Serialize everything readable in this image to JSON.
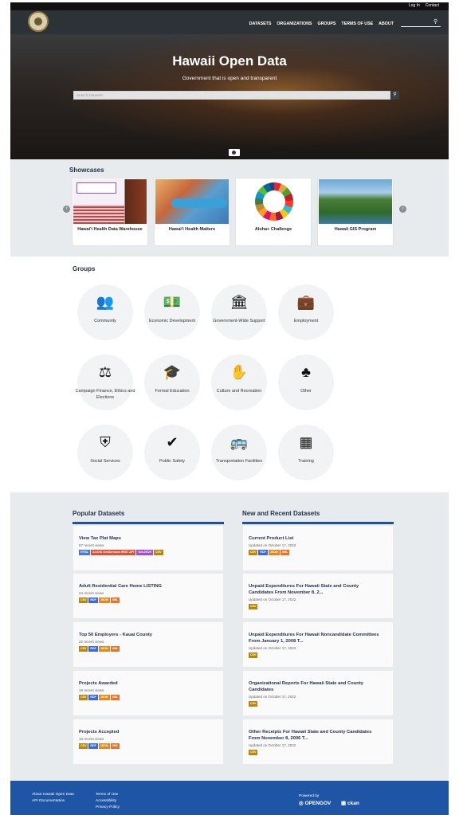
{
  "topbar": {
    "login": "Log In",
    "contact": "Contact"
  },
  "nav": {
    "items": [
      "DATASETS",
      "ORGANIZATIONS",
      "GROUPS",
      "TERMS OF USE",
      "ABOUT"
    ],
    "search_icon": "search-icon"
  },
  "hero": {
    "title": "Hawaii Open Data",
    "subtitle": "Government that is open and transparent",
    "search_placeholder": "Search Datasets",
    "search_icon": "search-icon"
  },
  "showcases": {
    "title": "Showcases",
    "items": [
      {
        "label": "Hawai'i Health Data Warehouse"
      },
      {
        "label": "Hawai'i Health Matters"
      },
      {
        "label": "Aloha+ Challenge"
      },
      {
        "label": "Hawaii GIS Program"
      }
    ],
    "prev_icon": "chevron-left-icon",
    "next_icon": "chevron-right-icon"
  },
  "groups": {
    "title": "Groups",
    "items": [
      {
        "label": "Community",
        "icon": "people-icon"
      },
      {
        "label": "Economic Development",
        "icon": "money-icon"
      },
      {
        "label": "Government-Wide Support",
        "icon": "building-icon"
      },
      {
        "label": "Employment",
        "icon": "employment-icon"
      },
      {
        "label": "Campaign Finance, Ethics and Elections",
        "icon": "campaign-icon"
      },
      {
        "label": "Formal Education",
        "icon": "graduation-cap-icon"
      },
      {
        "label": "Culture and Recreation",
        "icon": "hands-icon"
      },
      {
        "label": "Other",
        "icon": "puzzle-icon"
      },
      {
        "label": "Social Services",
        "icon": "shield-icon"
      },
      {
        "label": "Public Safety",
        "icon": "badge-check-icon"
      },
      {
        "label": "Transportation Facilities",
        "icon": "bus-icon"
      },
      {
        "label": "Training",
        "icon": "board-icon"
      }
    ]
  },
  "popular": {
    "title": "Popular Datasets",
    "items": [
      {
        "title": "View Tax Plat Maps",
        "meta": "87 recent views",
        "tags": [
          "HTML",
          "ArcGIS GeoServices REST API",
          "GeoJSON",
          "CSV"
        ]
      },
      {
        "title": "Adult Residential Care Home LISTING",
        "meta": "24 recent views",
        "tags": [
          "CSV",
          "RDF",
          "JSON",
          "XML"
        ]
      },
      {
        "title": "Top 50 Employers - Kauai County",
        "meta": "22 recent views",
        "tags": [
          "CSV",
          "RDF",
          "JSON",
          "XML"
        ]
      },
      {
        "title": "Projects Awarded",
        "meta": "19 recent views",
        "tags": [
          "CSV",
          "RDF",
          "JSON",
          "XML"
        ]
      },
      {
        "title": "Projects Accepted",
        "meta": "18 recent views",
        "tags": [
          "CSV",
          "RDF",
          "JSON",
          "XML"
        ]
      }
    ]
  },
  "recent": {
    "title": "New and Recent Datasets",
    "items": [
      {
        "title": "Current Product List",
        "meta": "Updated on October 17, 2022",
        "tags": [
          "CSV",
          "RDF",
          "JSON",
          "XML"
        ]
      },
      {
        "title": "Unpaid Expenditures For Hawaii State and County Candidates From November 8, 2...",
        "meta": "Updated on October 17, 2022",
        "tags": [
          "CSV"
        ]
      },
      {
        "title": "Unpaid Expenditures For Hawaii Noncandidate Committees From January 1, 2008 T...",
        "meta": "Updated on October 17, 2022",
        "tags": [
          "CSV"
        ]
      },
      {
        "title": "Organizational Reports For Hawaii State and County Candidates",
        "meta": "Updated on October 17, 2022",
        "tags": [
          "CSV"
        ]
      },
      {
        "title": "Other Receipts For Hawaii State and County Candidates From November 8, 2006 T...",
        "meta": "Updated on October 17, 2022",
        "tags": [
          "CSV"
        ]
      }
    ]
  },
  "tag_colors": {
    "HTML": "#4a7bd0",
    "ArcGIS GeoServices REST API": "#d9533b",
    "GeoJSON": "#a84cc9",
    "CSV": "#b8860b",
    "RDF": "#3b6bd9",
    "JSON": "#e08a1e",
    "XML": "#e8742a"
  },
  "footer": {
    "col1": [
      "About Hawaii Open Data",
      "API Documentation"
    ],
    "col2": [
      "Terms of Use",
      "Accessibility",
      "Privacy Policy"
    ],
    "powered_by": "Powered by",
    "opengov": "OPENGOV",
    "ckan": "ckan"
  }
}
